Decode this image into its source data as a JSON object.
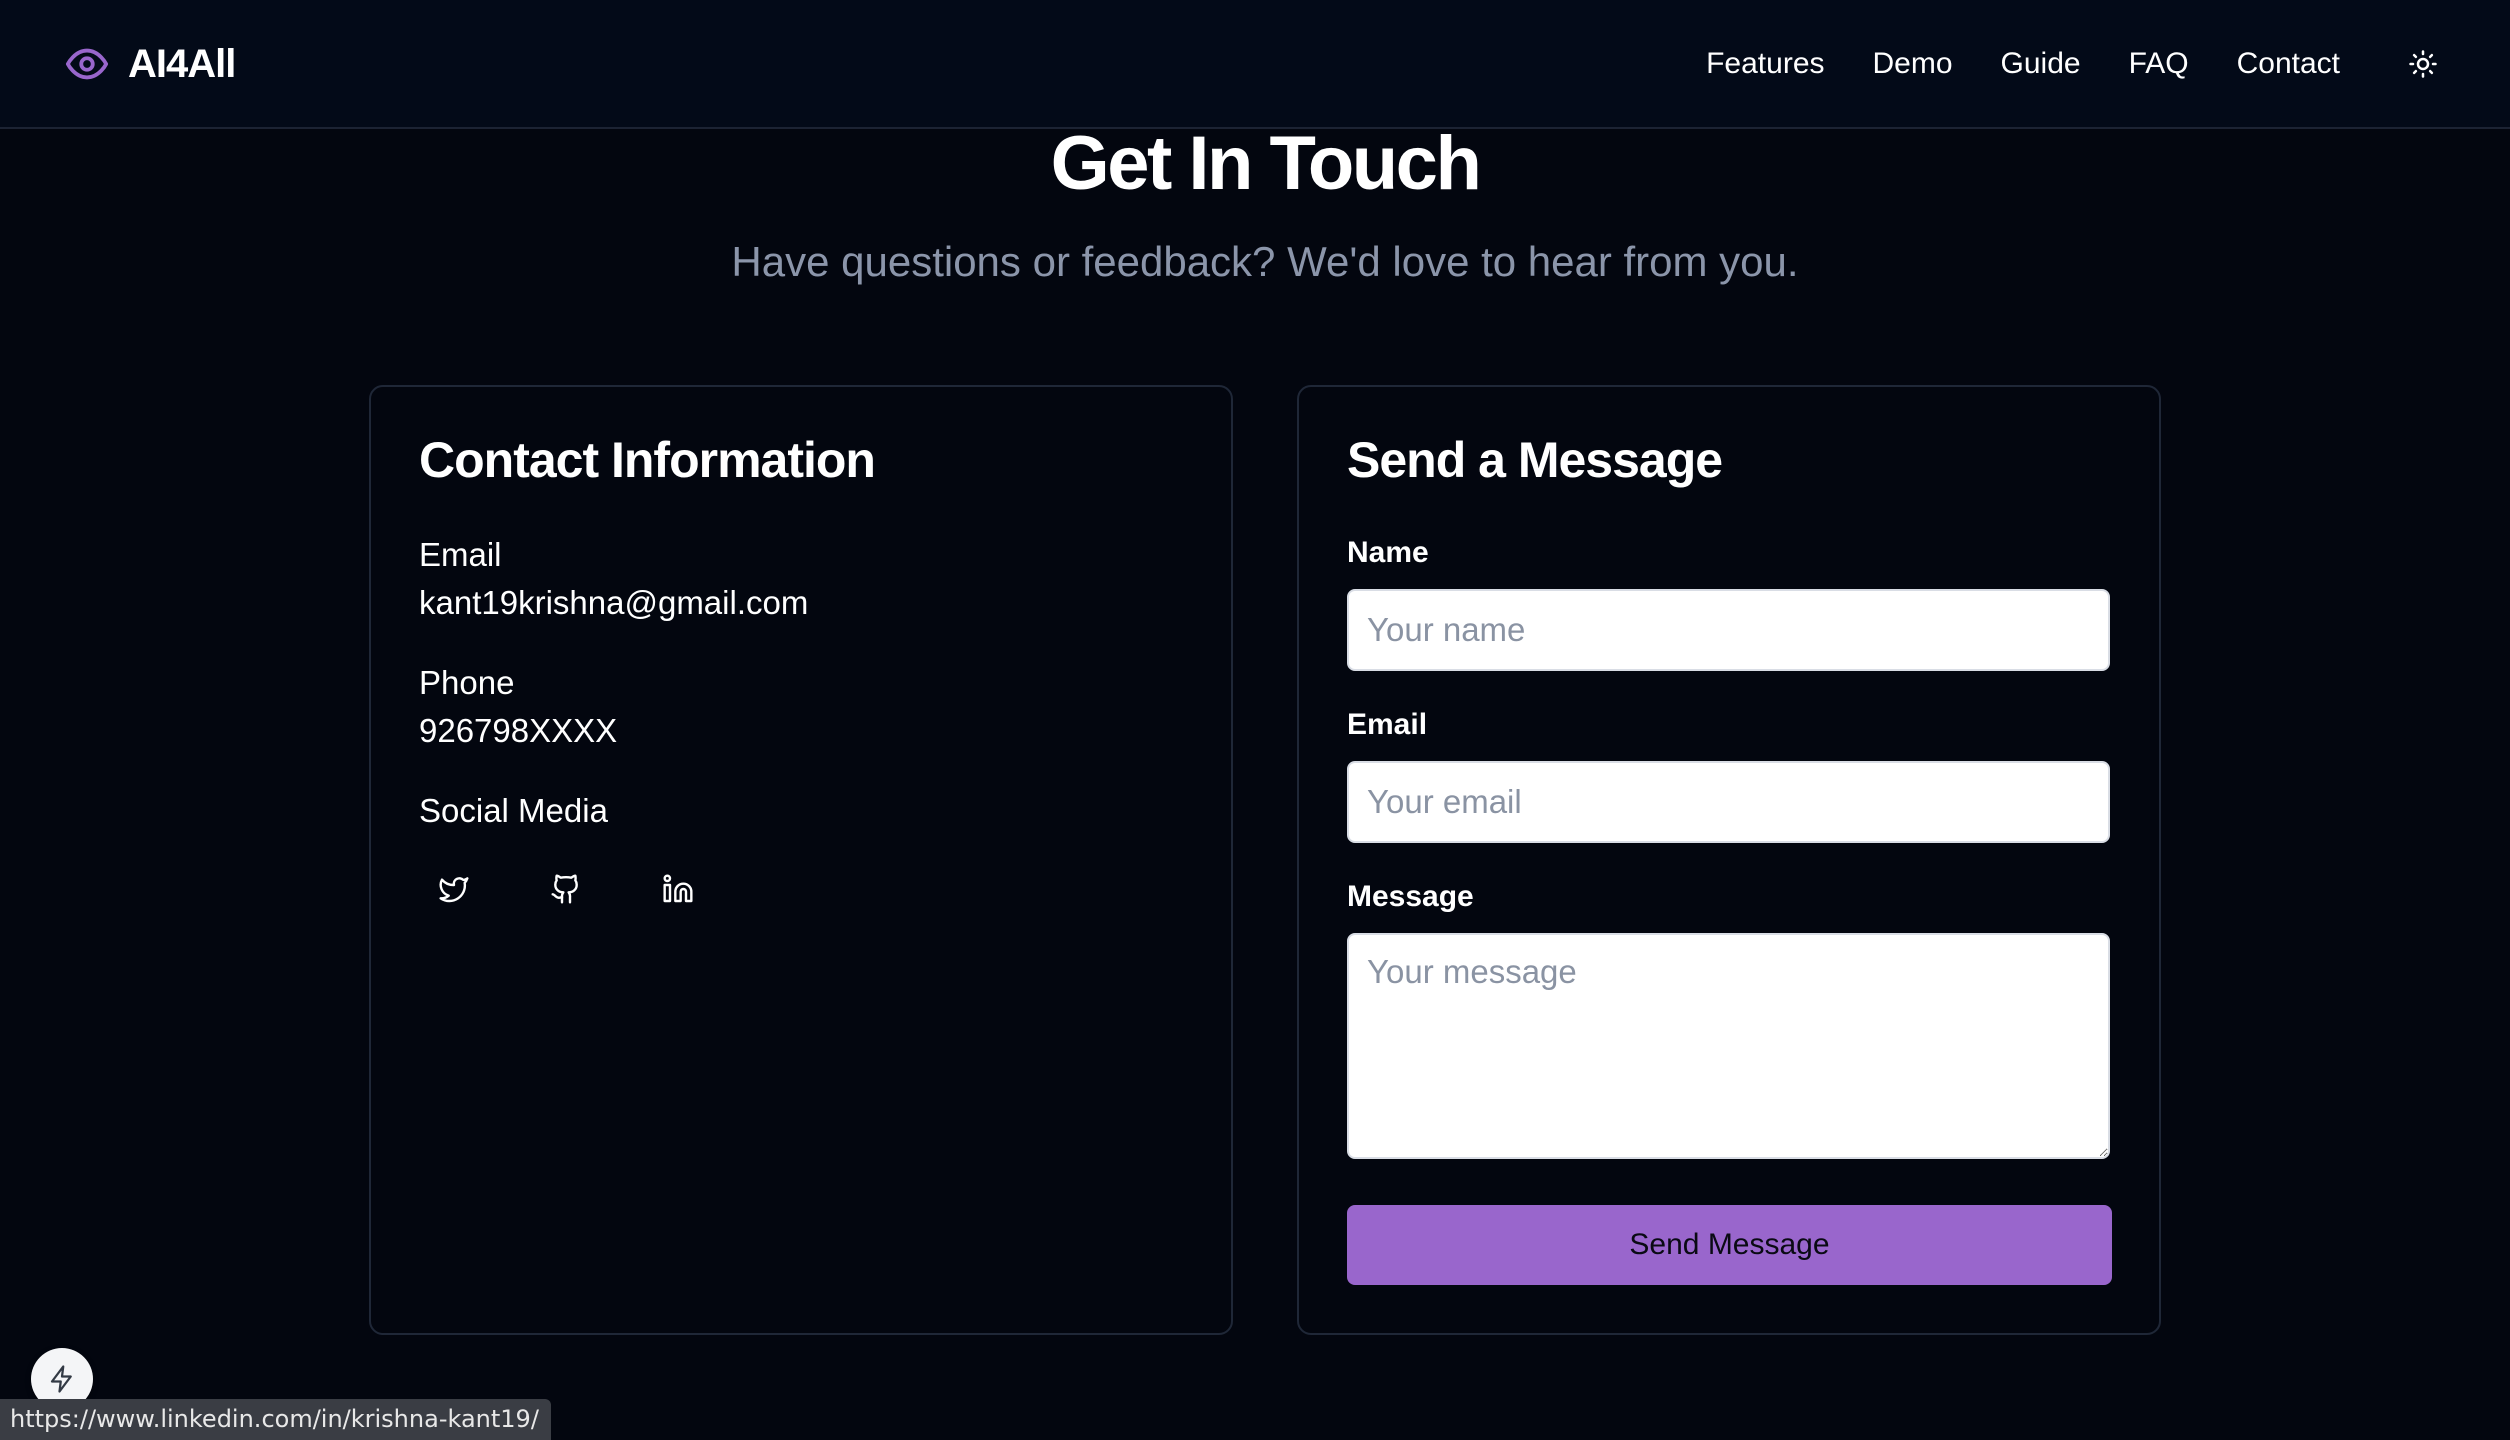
{
  "header": {
    "brand": "AI4All",
    "logo_icon": "eye-icon",
    "nav": [
      "Features",
      "Demo",
      "Guide",
      "FAQ",
      "Contact"
    ],
    "theme_icon": "sun-icon"
  },
  "hero": {
    "title": "Get In Touch",
    "subtitle": "Have questions or feedback? We'd love to hear from you."
  },
  "contact_info": {
    "title": "Contact Information",
    "email_label": "Email",
    "email_value": "kant19krishna@gmail.com",
    "phone_label": "Phone",
    "phone_value": "926798XXXX",
    "social_label": "Social Media",
    "social_icons": [
      "twitter-icon",
      "github-icon",
      "linkedin-icon"
    ]
  },
  "message_form": {
    "title": "Send a Message",
    "name_label": "Name",
    "name_placeholder": "Your name",
    "email_label": "Email",
    "email_placeholder": "Your email",
    "message_label": "Message",
    "message_placeholder": "Your message",
    "submit_label": "Send Message"
  },
  "floating_button": {
    "icon": "bolt-icon"
  },
  "status_bar": {
    "url": "https://www.linkedin.com/in/krishna-kant19/"
  },
  "colors": {
    "background": "#03060f",
    "accent": "#9966cc",
    "muted_text": "#8b95aa"
  }
}
